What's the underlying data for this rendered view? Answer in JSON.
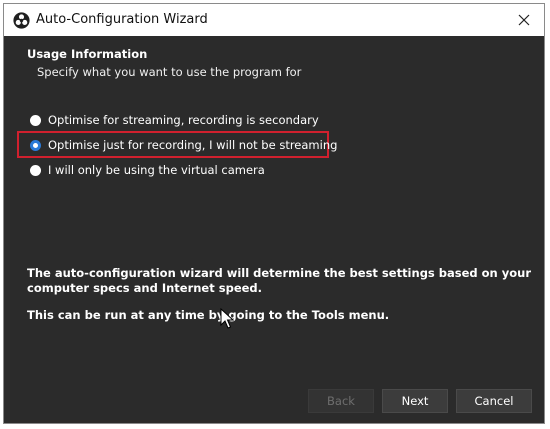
{
  "window": {
    "title": "Auto-Configuration Wizard"
  },
  "page": {
    "title": "Usage Information",
    "subtitle": "Specify what you want to use the program for"
  },
  "options": [
    {
      "label": "Optimise for streaming, recording is secondary",
      "checked": false
    },
    {
      "label": "Optimise just for recording, I will not be streaming",
      "checked": true
    },
    {
      "label": "I will only be using the virtual camera",
      "checked": false
    }
  ],
  "info": {
    "paragraph1_line1": "The auto-configuration wizard will determine the best settings based on your",
    "paragraph1_line2": "computer specs and Internet speed.",
    "paragraph2": "This can be run at any time by going to the Tools menu."
  },
  "buttons": {
    "back": "Back",
    "next": "Next",
    "cancel": "Cancel"
  },
  "icons": {
    "app": "obs-logo-icon",
    "close": "close-icon",
    "cursor": "mouse-pointer-icon"
  },
  "colors": {
    "background": "#2b2b2b",
    "highlight": "#d0202e",
    "radio_accent": "#2a7ad8"
  }
}
